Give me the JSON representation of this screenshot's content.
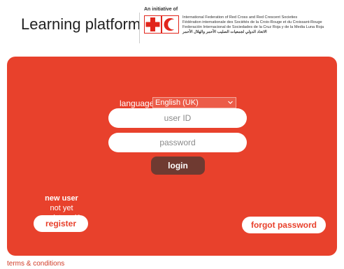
{
  "header": {
    "title": "Learning platform",
    "initiative": "An initiative of",
    "logo": "ifrc-red-cross-red-crescent-logo",
    "organizations": [
      "International Federation of Red Cross and Red Crescent Societies",
      "Fédération internationale des Sociétés de la Croix-Rouge et du Croissant-Rouge",
      "Federación Internacional de Sociedades de la Cruz Roja y de la Media Luna Roja",
      "الاتحاد الدولي لجمعيات الصليب الأحمر والهلال الأحمر"
    ]
  },
  "colors": {
    "panel": "#e8412c",
    "login_button": "#6f3a31",
    "text_white": "#ffffff",
    "logo_red": "#e1251b"
  },
  "login": {
    "language_label": "language",
    "language_selected": "English (UK)",
    "user_id_placeholder": "user ID",
    "password_placeholder": "password",
    "login_label": "login"
  },
  "registration": {
    "new_user": "new user",
    "not_registered": "not yet registered?",
    "register_label": "register"
  },
  "forgot_password_label": "forgot password",
  "footer": {
    "terms": "terms & conditions"
  }
}
